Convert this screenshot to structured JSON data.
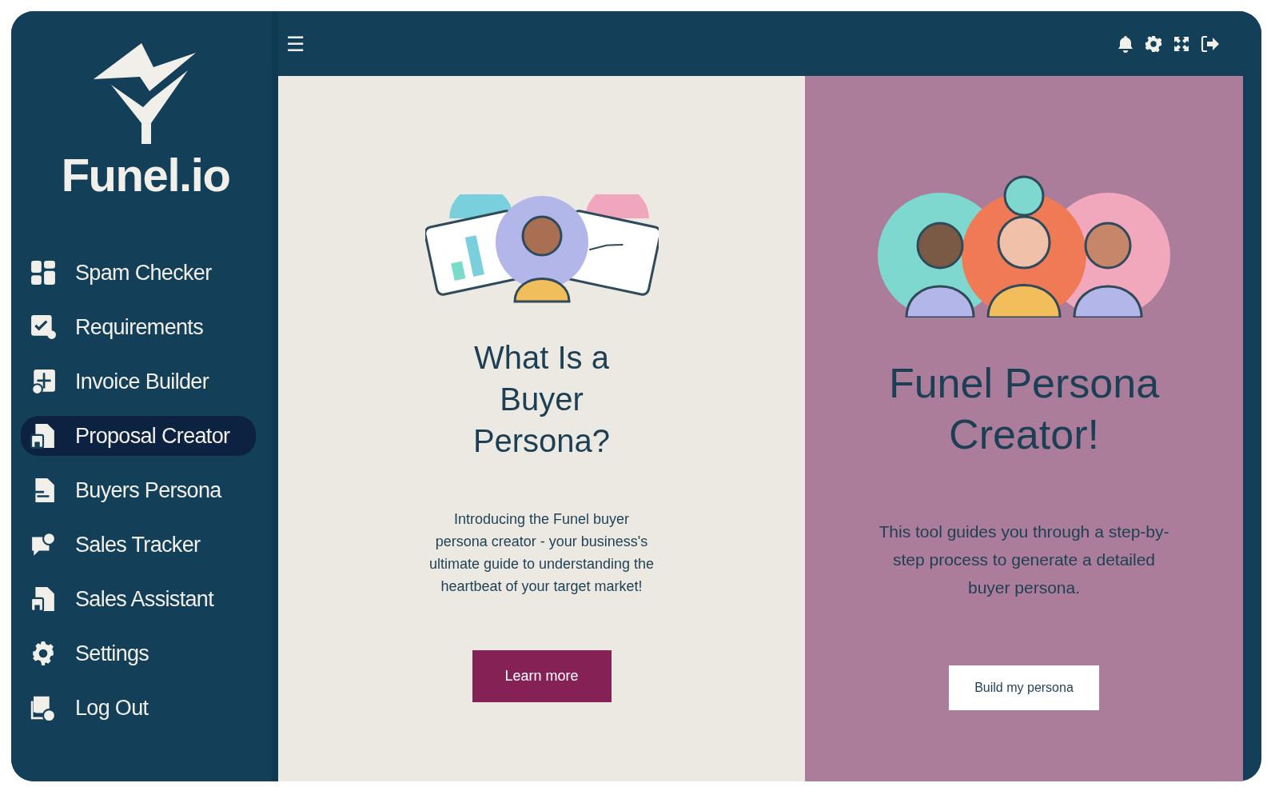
{
  "brand": {
    "name": "Funel.io"
  },
  "sidebar": {
    "items": [
      {
        "label": "Spam Checker",
        "kind": "grid",
        "selected": false
      },
      {
        "label": "Requirements",
        "kind": "checklist",
        "selected": false
      },
      {
        "label": "Invoice Builder",
        "kind": "invoice",
        "selected": false
      },
      {
        "label": "Proposal Creator",
        "kind": "file",
        "selected": true
      },
      {
        "label": "Buyers Persona",
        "kind": "document",
        "selected": false
      },
      {
        "label": "Sales Tracker",
        "kind": "chat",
        "selected": false
      },
      {
        "label": "Sales Assistant",
        "kind": "file",
        "selected": false
      },
      {
        "label": "Settings",
        "kind": "gear",
        "selected": false
      },
      {
        "label": "Log Out",
        "kind": "logout",
        "selected": false
      }
    ]
  },
  "topbar": {
    "menu_glyph": "☰"
  },
  "intro_card": {
    "heading": "What Is a Buyer Persona?",
    "body": "Introducing the Funel buyer persona creator - your business's ultimate guide to understanding the heartbeat of your target market!",
    "button": "Learn more"
  },
  "creator_card": {
    "heading": "Funel Persona Creator!",
    "body": "This tool guides you through a step-by-step process to generate a detailed buyer persona.",
    "button": "Build my persona"
  }
}
